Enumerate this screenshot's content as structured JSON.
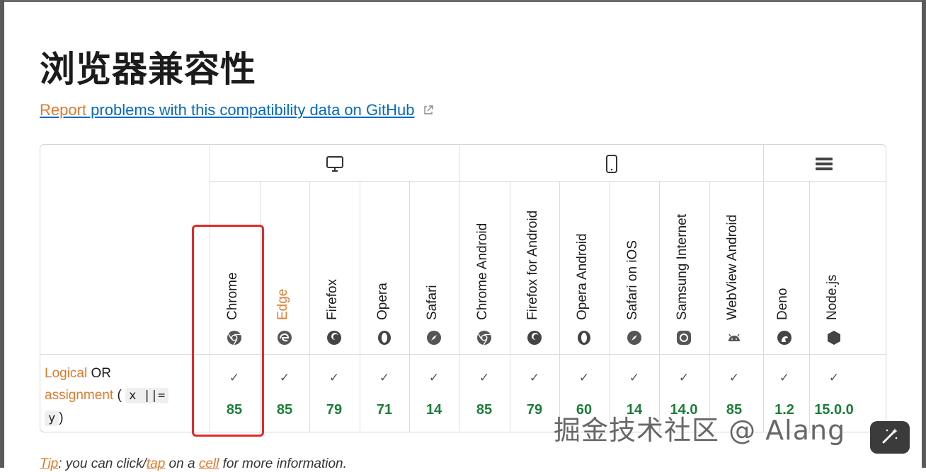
{
  "page": {
    "title": "浏览器兼容性",
    "report_link_part1": "Report",
    "report_link_part2": " problems with this compatibility data on GitHub"
  },
  "platforms": [
    {
      "name": "desktop",
      "icon": "desktop-icon"
    },
    {
      "name": "mobile",
      "icon": "mobile-icon"
    },
    {
      "name": "server",
      "icon": "server-icon"
    }
  ],
  "browsers": [
    {
      "name": "Chrome",
      "icon": "chrome-icon",
      "highlight_name": false
    },
    {
      "name": "Edge",
      "icon": "edge-icon",
      "highlight_name": true
    },
    {
      "name": "Firefox",
      "icon": "firefox-icon",
      "highlight_name": false
    },
    {
      "name": "Opera",
      "icon": "opera-icon",
      "highlight_name": false
    },
    {
      "name": "Safari",
      "icon": "safari-icon",
      "highlight_name": false
    },
    {
      "name": "Chrome Android",
      "icon": "chrome-icon",
      "highlight_name": false
    },
    {
      "name": "Firefox for Android",
      "icon": "firefox-icon",
      "highlight_name": false
    },
    {
      "name": "Opera Android",
      "icon": "opera-icon",
      "highlight_name": false
    },
    {
      "name": "Safari on iOS",
      "icon": "safari-icon",
      "highlight_name": false
    },
    {
      "name": "Samsung Internet",
      "icon": "samsung-internet-icon",
      "highlight_name": false
    },
    {
      "name": "WebView Android",
      "icon": "android-icon",
      "highlight_name": false
    },
    {
      "name": "Deno",
      "icon": "deno-icon",
      "highlight_name": false
    },
    {
      "name": "Node.js",
      "icon": "nodejs-icon",
      "highlight_name": false
    }
  ],
  "feature": {
    "name_part1": "Logical",
    "name_part2": " OR",
    "name_part3": "assignment",
    "code1": "x ||=",
    "code2": "y",
    "paren_open": " (",
    "paren_close": ")"
  },
  "support": [
    {
      "supported": true,
      "version": "85"
    },
    {
      "supported": true,
      "version": "85"
    },
    {
      "supported": true,
      "version": "79"
    },
    {
      "supported": true,
      "version": "71"
    },
    {
      "supported": true,
      "version": "14"
    },
    {
      "supported": true,
      "version": "85"
    },
    {
      "supported": true,
      "version": "79"
    },
    {
      "supported": true,
      "version": "60"
    },
    {
      "supported": true,
      "version": "14"
    },
    {
      "supported": true,
      "version": "14.0"
    },
    {
      "supported": true,
      "version": "85"
    },
    {
      "supported": true,
      "version": "1.2"
    },
    {
      "supported": true,
      "version": "15.0.0"
    }
  ],
  "check_mark": "✓",
  "tip": {
    "tip_word": "Tip",
    "part1": ": you can click/",
    "tap_word": "tap",
    "part2": " on a ",
    "cell_word": "cell",
    "part3": " for more information."
  },
  "watermark": "掘金技术社区 @ Alang",
  "colors": {
    "link_blue": "#0069c2",
    "accent_orange": "#e07a2c",
    "version_green": "#1a7f37",
    "highlight_red": "#e02a2a"
  }
}
